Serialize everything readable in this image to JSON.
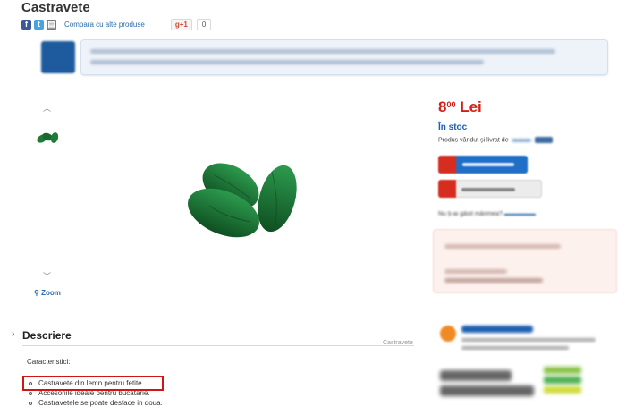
{
  "product": {
    "title": "Castravete",
    "compare_link": "Compara cu alte produse",
    "gplus_label": "+1",
    "gplus_count": "0",
    "zoom_label": "Zoom"
  },
  "offer": {
    "price_main": "8",
    "price_cents": "00",
    "currency": "Lei",
    "stock": "În stoc",
    "seller_prefix": "Produs vândut și livrat de",
    "question_prefix": "Nu ți-ai găsit mărimea?"
  },
  "description": {
    "title": "Descriere",
    "crumb": "Castravete",
    "subtitle": "Caracteristici:",
    "features": [
      "Castravete din lemn pentru fetite.",
      "Accesoriile ideale pentru bucatarie.",
      "Castravetele se poate desface in doua."
    ]
  },
  "colors": {
    "accent_red": "#d41e16",
    "link_blue": "#2a6db0",
    "stock_blue": "#1e5fb0",
    "cucumber_green": "#1f7a3a",
    "highlight_border": "#d01515"
  },
  "icons": [
    "facebook-icon",
    "twitter-icon",
    "print-icon",
    "google-plus-icon",
    "arrow-up-icon",
    "arrow-down-icon",
    "zoom-icon",
    "cart-icon",
    "wishlist-icon"
  ]
}
